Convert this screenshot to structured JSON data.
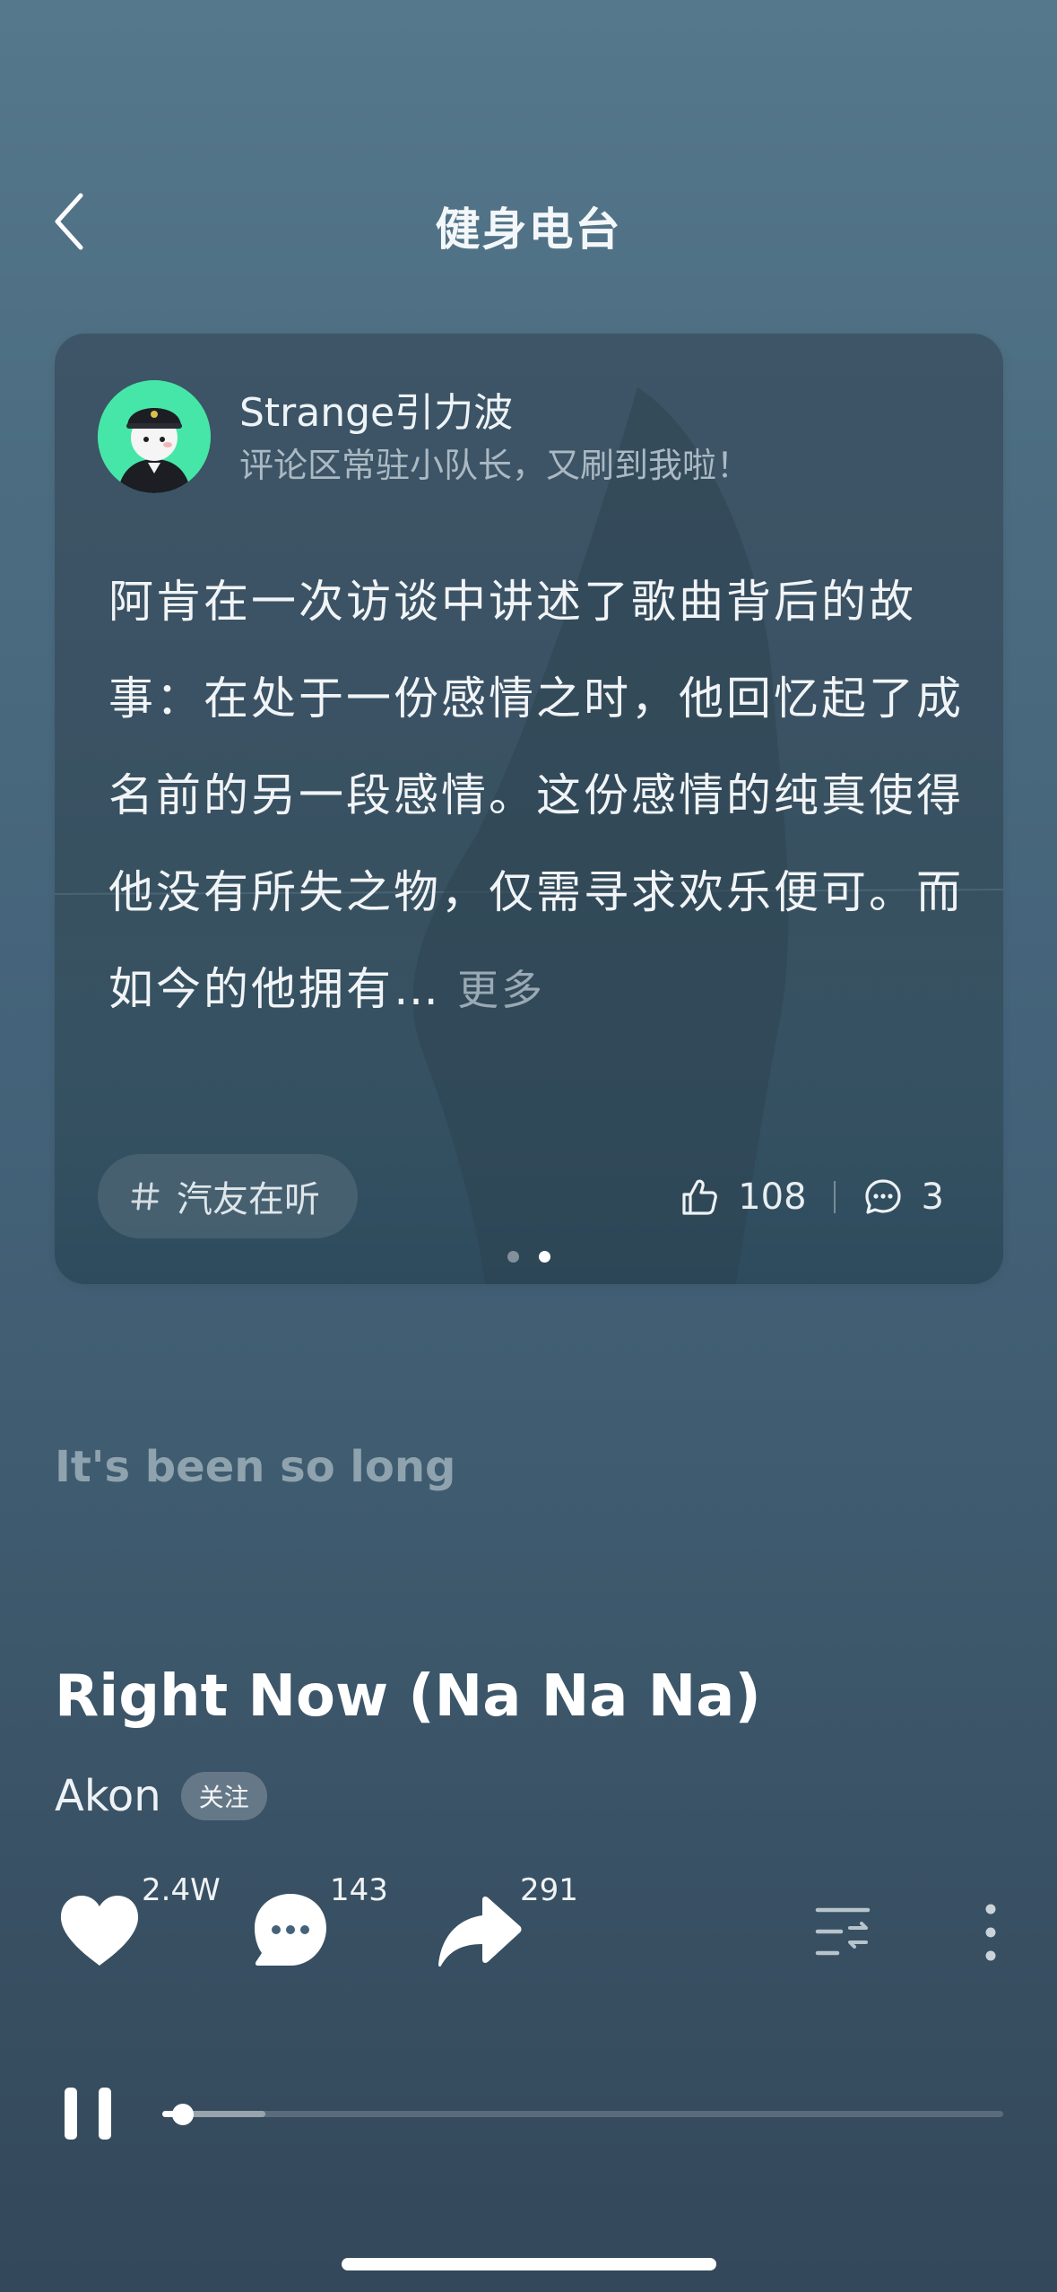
{
  "header": {
    "title": "健身电台",
    "back_icon": "chevron-left-icon"
  },
  "comment_card": {
    "username": "Strange引力波",
    "signature": "评论区常驻小队长，又刷到我啦！",
    "text": "阿肯在一次访谈中讲述了歌曲背后的故事：在处于一份感情之时，他回忆起了成名前的另一段感情。这份感情的纯真使得他没有所失之物，仅需寻求欢乐便可。而如今的他拥有…",
    "more_label": "更多",
    "tag": "汽友在听",
    "likes": "108",
    "comments": "3",
    "page_count": 2,
    "active_page": 2,
    "colors": {
      "avatar_bg": "#46e6a8"
    }
  },
  "lyric": "It's been so long",
  "song": {
    "title": "Right Now (Na Na Na)",
    "artist": "Akon",
    "follow_label": "关注"
  },
  "actions": {
    "like_count": "2.4W",
    "comment_count": "143",
    "share_count": "291",
    "icons": [
      "heart-icon",
      "comment-bubble-icon",
      "share-arrow-icon",
      "playlist-icon",
      "more-vertical-icon"
    ]
  },
  "player": {
    "state": "playing",
    "progress_fraction": 0.025,
    "buffered_fraction": 0.123
  }
}
